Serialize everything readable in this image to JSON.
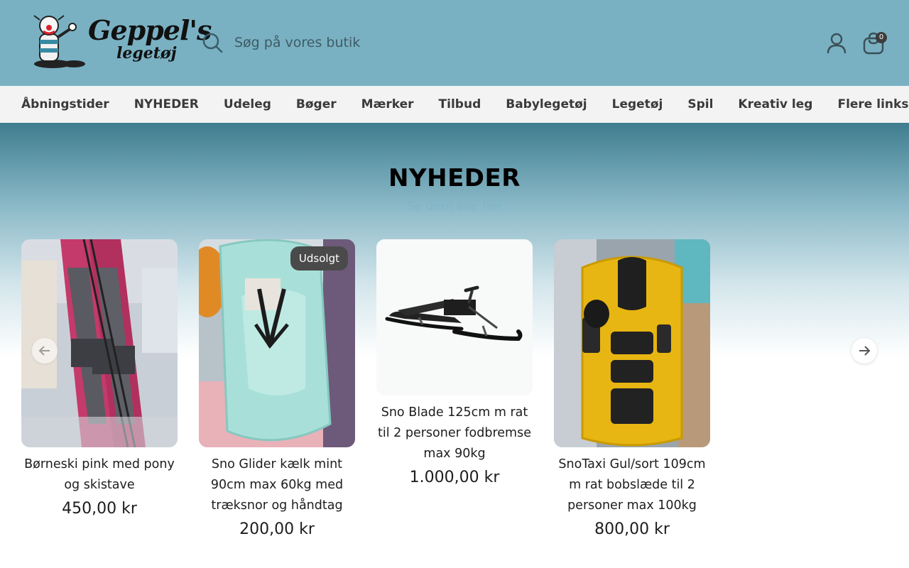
{
  "header": {
    "logo_text_line1": "Geppel's",
    "logo_text_line2": "legetøj",
    "search_placeholder": "Søg på vores butik",
    "cart_count": "0"
  },
  "nav": {
    "items": [
      "Åbningstider",
      "NYHEDER",
      "Udeleg",
      "Bøger",
      "Mærker",
      "Tilbud",
      "Babylegetøj",
      "Legetøj",
      "Spil",
      "Kreativ leg"
    ],
    "more_label": "Flere links"
  },
  "section": {
    "title": "NYHEDER",
    "link": "Se dem alle her"
  },
  "products": [
    {
      "title": "Børneski pink med pony og skistave",
      "price": "450,00 kr"
    },
    {
      "title": "Sno Glider kælk mint 90cm max 60kg med træksnor og håndtag",
      "price": "200,00 kr",
      "badge": "Udsolgt"
    },
    {
      "title": "Sno Blade 125cm m rat til 2 personer fodbremse max 90kg",
      "price": "1.000,00 kr"
    },
    {
      "title": "SnoTaxi Gul/sort 109cm m rat bobslæde til 2 personer max 100kg",
      "price": "800,00 kr"
    }
  ],
  "colors": {
    "header_bg": "#79b1c3",
    "nav_bg": "#f3f3f3",
    "badge_bg": "#4a4a4a",
    "link": "#7fb6c9"
  }
}
